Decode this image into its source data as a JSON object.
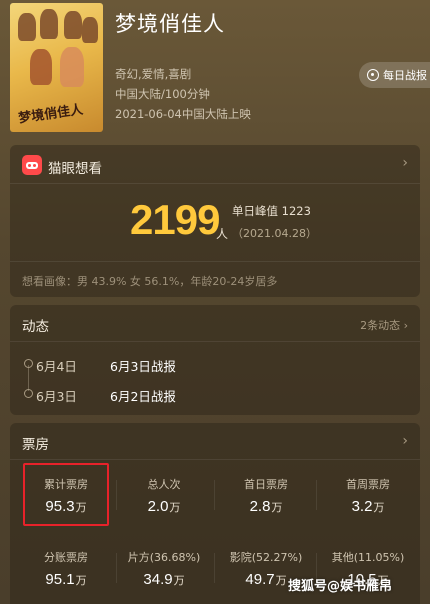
{
  "movie": {
    "title": "梦境俏佳人",
    "genres": "奇幻,爱情,喜剧",
    "region_duration": "中国大陆/100分钟",
    "release": "2021-06-04中国大陆上映",
    "poster_text": "梦境俏佳人",
    "daily_report_label": "每日战报"
  },
  "want": {
    "section_title": "猫眼想看",
    "count": "2199",
    "unit": "人",
    "peak_label": "单日峰值 1223",
    "peak_date": "（2021.04.28）",
    "portrait": "想看画像：男 43.9%  女 56.1%，年龄20-24岁居多"
  },
  "news": {
    "section_title": "动态",
    "count_label": "2条动态 ›",
    "items": [
      {
        "date": "6月4日",
        "text": "6月3日战报"
      },
      {
        "date": "6月3日",
        "text": "6月2日战报"
      }
    ]
  },
  "boxoffice": {
    "section_title": "票房",
    "stats_row1": [
      {
        "label": "累计票房",
        "value": "95.3",
        "unit": "万"
      },
      {
        "label": "总人次",
        "value": "2.0",
        "unit": "万"
      },
      {
        "label": "首日票房",
        "value": "2.8",
        "unit": "万"
      },
      {
        "label": "首周票房",
        "value": "3.2",
        "unit": "万"
      }
    ],
    "stats_row2": [
      {
        "label": "分账票房",
        "value": "95.1",
        "unit": "万"
      },
      {
        "label": "片方(36.68%)",
        "value": "34.9",
        "unit": "万"
      },
      {
        "label": "影院(52.27%)",
        "value": "49.7",
        "unit": "万"
      },
      {
        "label": "其他(11.05%)",
        "value": "10.5",
        "unit": "万"
      }
    ]
  },
  "watermark": "搜狐号@娱书雁帛",
  "icons": {
    "chevron": "chevron-right-icon",
    "daily": "badge-icon",
    "logo": "maoyan-cat-icon"
  }
}
